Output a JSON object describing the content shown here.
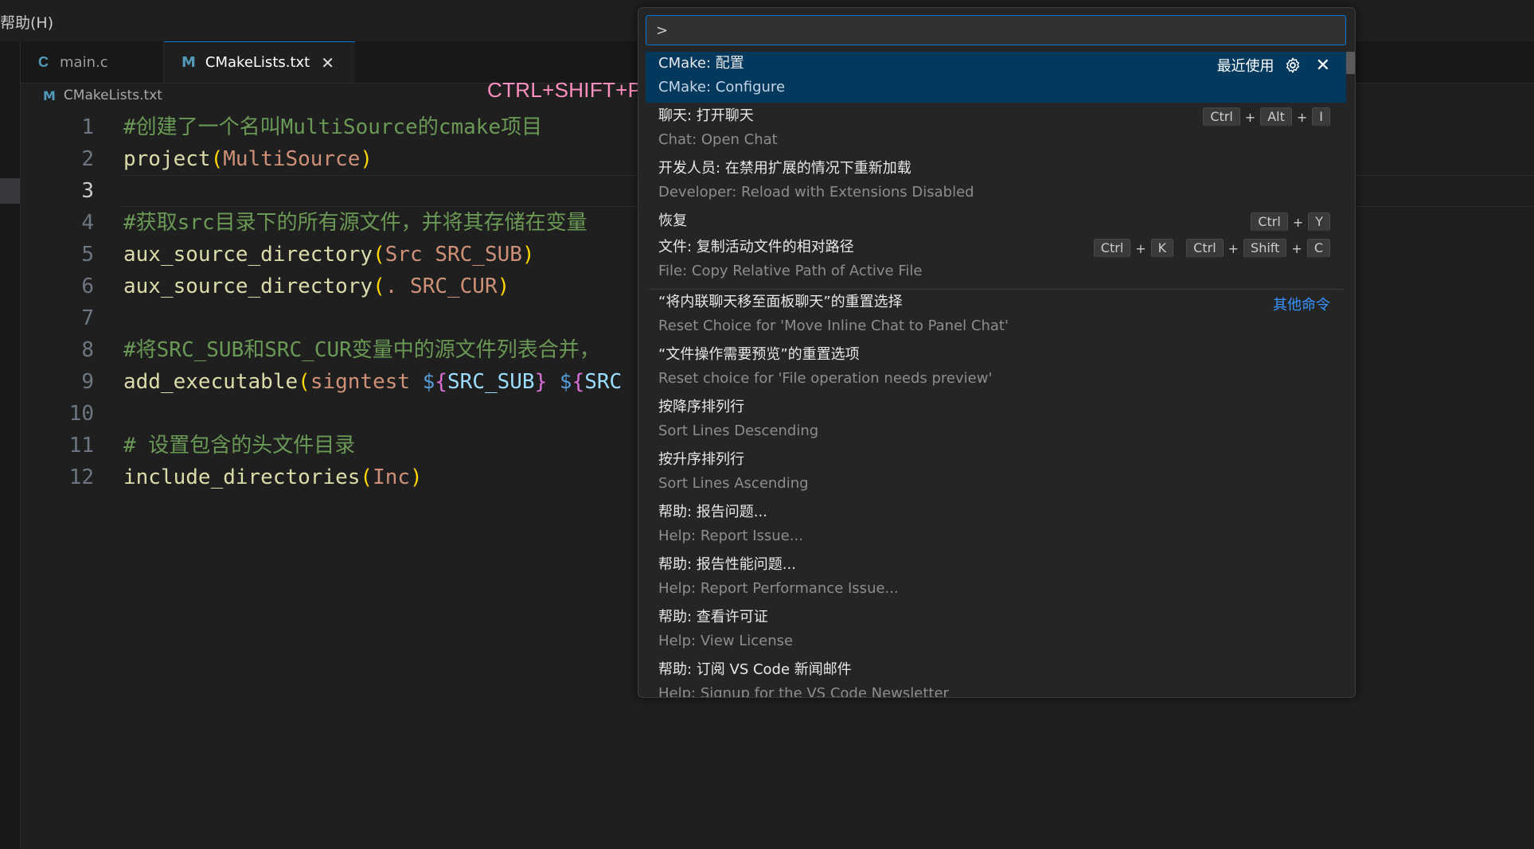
{
  "menubar": {
    "help": "帮助(H)"
  },
  "tabs": [
    {
      "label": "main.c",
      "icon": "C"
    },
    {
      "label": "CMakeLists.txt",
      "icon": "M",
      "close": "✕"
    }
  ],
  "breadcrumb": {
    "icon": "M",
    "label": "CMakeLists.txt"
  },
  "overlay_hint": "CTRL+SHIFT+P",
  "editor": {
    "lines": [
      {
        "n": "1",
        "comment": "#创建了一个名叫MultiSource的cmake项目"
      },
      {
        "n": "2",
        "func": "project",
        "p1": "(",
        "arg": "MultiSource",
        "p2": ")"
      },
      {
        "n": "3"
      },
      {
        "n": "4",
        "comment": "#获取src目录下的所有源文件，并将其存储在变量"
      },
      {
        "n": "5",
        "func": "aux_source_directory",
        "p1": "(",
        "arg": "Src SRC_SUB",
        "p2": ")"
      },
      {
        "n": "6",
        "func": "aux_source_directory",
        "p1": "(",
        "arg": ". SRC_CUR",
        "p2": ")"
      },
      {
        "n": "7"
      },
      {
        "n": "8",
        "comment": "#将SRC_SUB和SRC_CUR变量中的源文件列表合并，"
      },
      {
        "n": "9",
        "func": "add_executable",
        "p1": "(",
        "arg": "signtest ",
        "d1": "$",
        "b1": "{",
        "v1": "SRC_SUB",
        "b2": "}",
        "sp": " ",
        "d2": "$",
        "b3": "{",
        "v2": "SRC"
      },
      {
        "n": "10"
      },
      {
        "n": "11",
        "comment": "# 设置包含的头文件目录"
      },
      {
        "n": "12",
        "func": "include_directories",
        "p1": "(",
        "arg": "Inc",
        "p2": ")"
      }
    ]
  },
  "palette": {
    "input_value": ">",
    "items": [
      {
        "label": "CMake: 配置",
        "detail": "CMake: Configure",
        "recent": "最近使用",
        "gear_icon": "gear-icon",
        "close": "✕"
      },
      {
        "label": "聊天: 打开聊天",
        "detail": "Chat: Open Chat",
        "keys": [
          "Ctrl",
          "Alt",
          "I"
        ]
      },
      {
        "label": "开发人员: 在禁用扩展的情况下重新加载",
        "detail": "Developer: Reload with Extensions Disabled"
      },
      {
        "label": "恢复",
        "keys": [
          "Ctrl",
          "Y"
        ]
      },
      {
        "label": "文件: 复制活动文件的相对路径",
        "detail": "File: Copy Relative Path of Active File",
        "chord1": [
          "Ctrl",
          "K"
        ],
        "chord2": [
          "Ctrl",
          "Shift",
          "C"
        ]
      },
      {
        "label": "“将内联聊天移至面板聊天”的重置选择",
        "detail": "Reset Choice for 'Move Inline Chat to Panel Chat'",
        "other": "其他命令"
      },
      {
        "label": "“文件操作需要预览”的重置选项",
        "detail": "Reset choice for 'File operation needs preview'"
      },
      {
        "label": "按降序排列行",
        "detail": "Sort Lines Descending"
      },
      {
        "label": "按升序排列行",
        "detail": "Sort Lines Ascending"
      },
      {
        "label": "帮助: 报告问题...",
        "detail": "Help: Report Issue..."
      },
      {
        "label": "帮助: 报告性能问题...",
        "detail": "Help: Report Performance Issue..."
      },
      {
        "label": "帮助: 查看许可证",
        "detail": "Help: View License"
      },
      {
        "label": "帮助: 订阅 VS Code 新闻邮件",
        "detail": "Help: Signup for the VS Code Newsletter"
      }
    ],
    "plus": "+"
  }
}
